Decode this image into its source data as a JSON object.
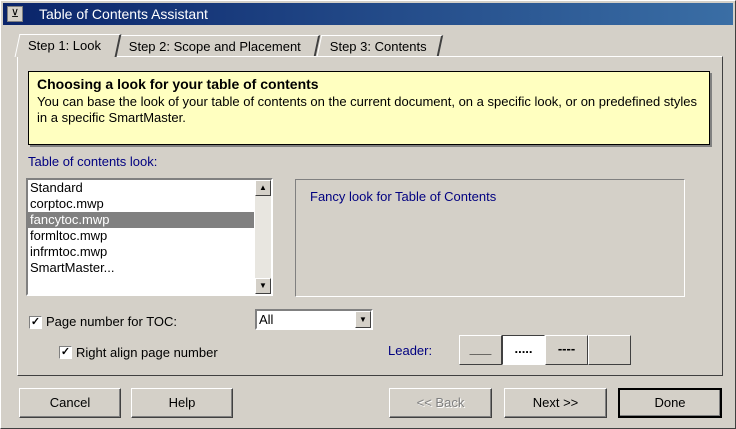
{
  "window": {
    "title": "Table of Contents Assistant",
    "icon": "tilde-icon"
  },
  "tabs": [
    {
      "label": "Step 1:  Look",
      "active": true
    },
    {
      "label": "Step 2:  Scope and Placement",
      "active": false
    },
    {
      "label": "Step 3:  Contents",
      "active": false
    }
  ],
  "info": {
    "heading": "Choosing a look for your table of contents",
    "text": "You can base the look of your table of contents on the current document, on a specific look, or on predefined styles in a specific SmartMaster."
  },
  "look": {
    "label": "Table of contents look:",
    "items": [
      "Standard",
      "corptoc.mwp",
      "fancytoc.mwp",
      "formltoc.mwp",
      "infrmtoc.mwp",
      "SmartMaster..."
    ],
    "selected": "fancytoc.mwp",
    "preview_text": "Fancy look for Table of Contents"
  },
  "options": {
    "page_number_label": "Page number for TOC:",
    "page_number_checked": true,
    "page_number_value": "All",
    "right_align_label": "Right align page number",
    "right_align_checked": true
  },
  "leader": {
    "label": "Leader:",
    "options": [
      "___",
      ".....",
      "----",
      ""
    ],
    "selected_index": 1
  },
  "buttons": {
    "cancel": "Cancel",
    "help": "Help",
    "back": "<< Back",
    "next": "Next >>",
    "done": "Done"
  }
}
